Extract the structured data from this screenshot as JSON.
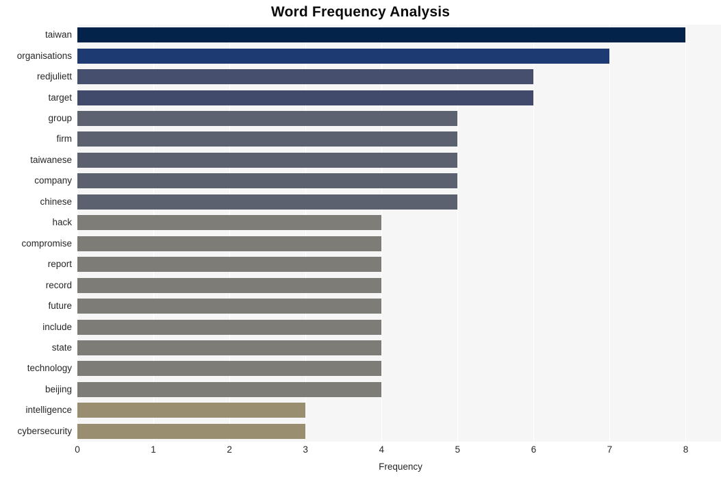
{
  "chart_data": {
    "type": "bar",
    "orientation": "horizontal",
    "title": "Word Frequency Analysis",
    "xlabel": "Frequency",
    "ylabel": "",
    "xlim": [
      0,
      8.5
    ],
    "xticks": [
      0,
      1,
      2,
      3,
      4,
      5,
      6,
      7,
      8
    ],
    "xtick_labels": [
      "0",
      "1",
      "2",
      "3",
      "4",
      "5",
      "6",
      "7",
      "8"
    ],
    "grid": "vertical-white-on-light-gray",
    "legend": "none",
    "categories": [
      "taiwan",
      "organisations",
      "redjuliett",
      "target",
      "group",
      "firm",
      "taiwanese",
      "company",
      "chinese",
      "hack",
      "compromise",
      "report",
      "record",
      "future",
      "include",
      "state",
      "technology",
      "beijing",
      "intelligence",
      "cybersecurity"
    ],
    "values": [
      8,
      7,
      6,
      6,
      5,
      5,
      5,
      5,
      5,
      4,
      4,
      4,
      4,
      4,
      4,
      4,
      4,
      4,
      3,
      3
    ],
    "bar_colors": [
      "#03234b",
      "#1e3a72",
      "#464f6e",
      "#414a6b",
      "#5d6270",
      "#5c616f",
      "#5c616f",
      "#5c616f",
      "#5c616f",
      "#7e7d78",
      "#7d7c77",
      "#7d7c77",
      "#7d7c77",
      "#7d7c77",
      "#7d7c77",
      "#7d7c77",
      "#7d7c77",
      "#7d7c77",
      "#998f70",
      "#998f70"
    ],
    "plot_background": "#f6f6f7",
    "gridline_color": "#ffffff",
    "figure_background": "#ffffff",
    "text_color": "#262626",
    "title_color": "#0b0b0c"
  }
}
